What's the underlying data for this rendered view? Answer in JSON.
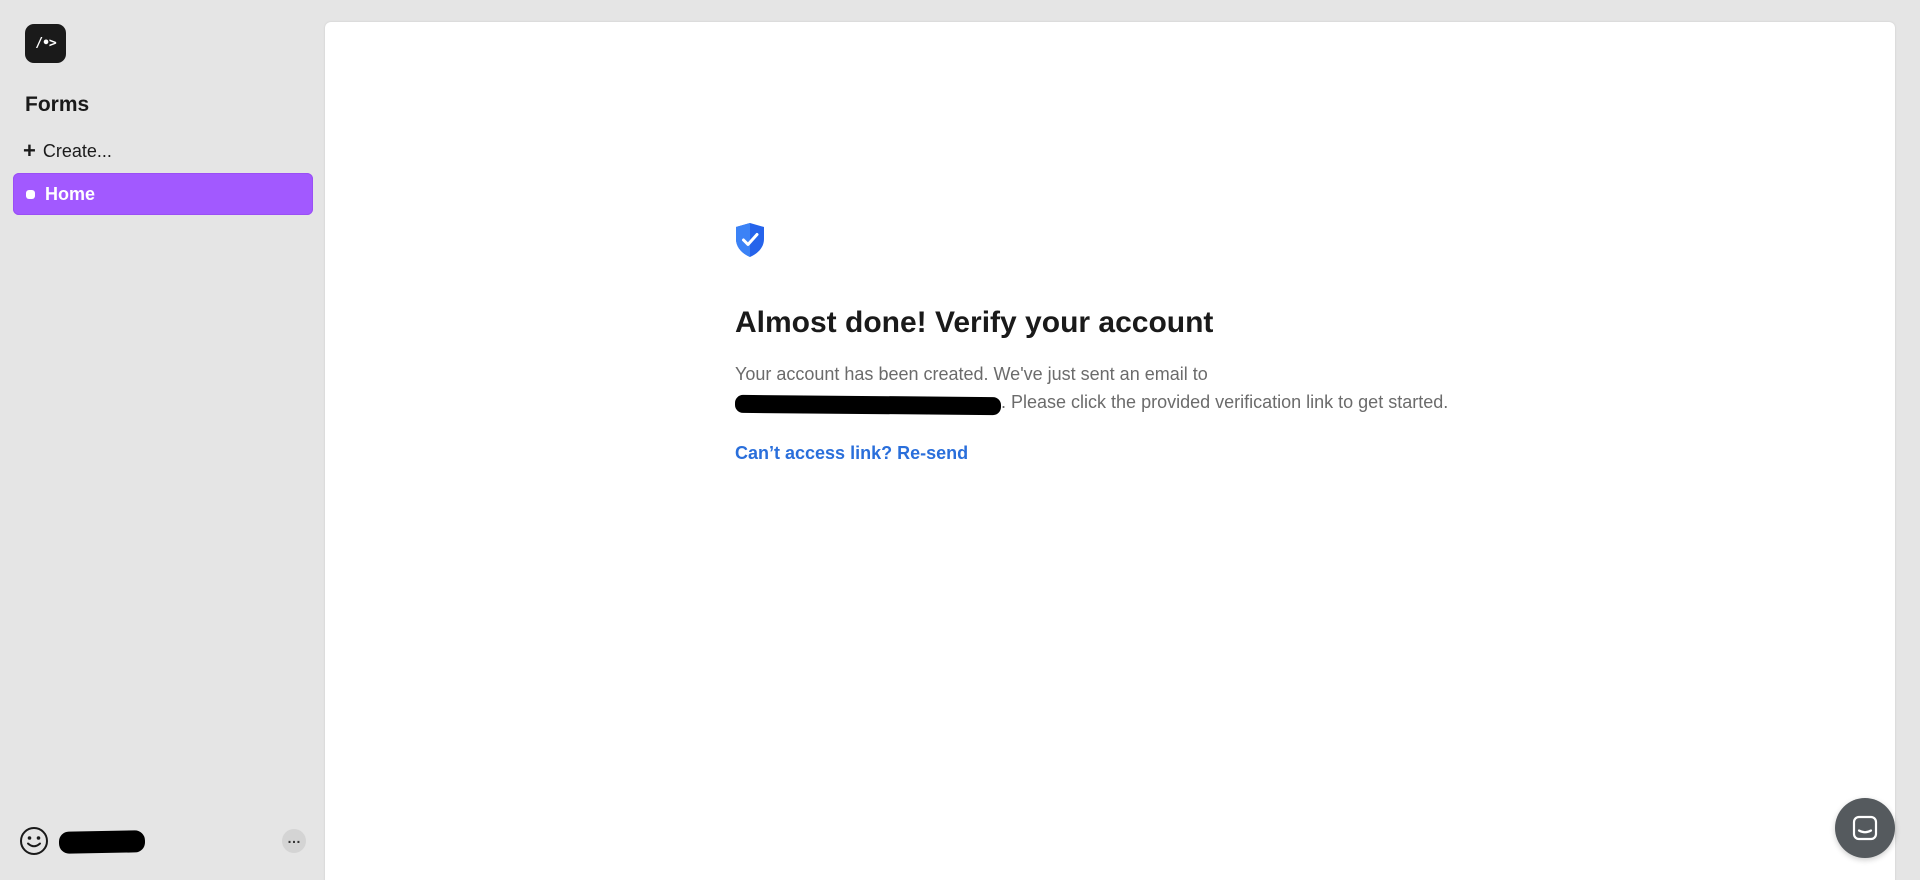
{
  "sidebar": {
    "logo_text": "/•>",
    "heading": "Forms",
    "create_label": "Create...",
    "items": [
      {
        "label": "Home",
        "active": true
      }
    ],
    "user": {
      "avatar_icon": "smiley-icon",
      "name_redacted": true,
      "more_icon": "ellipsis-icon"
    }
  },
  "main": {
    "icon": "shield-check-icon",
    "title": "Almost done! Verify your account",
    "description_line1": "Your account has been created. We've just sent an email to",
    "description_line2": ". Please click the provided verification link to get started.",
    "email_redacted": true,
    "resend_link": "Can’t access link? Re-send"
  },
  "chat_launcher": {
    "icon": "chat-icon"
  },
  "colors": {
    "accent": "#a259ff",
    "link": "#2a6fdb",
    "shield": "#2563eb",
    "background": "#e5e5e5"
  }
}
